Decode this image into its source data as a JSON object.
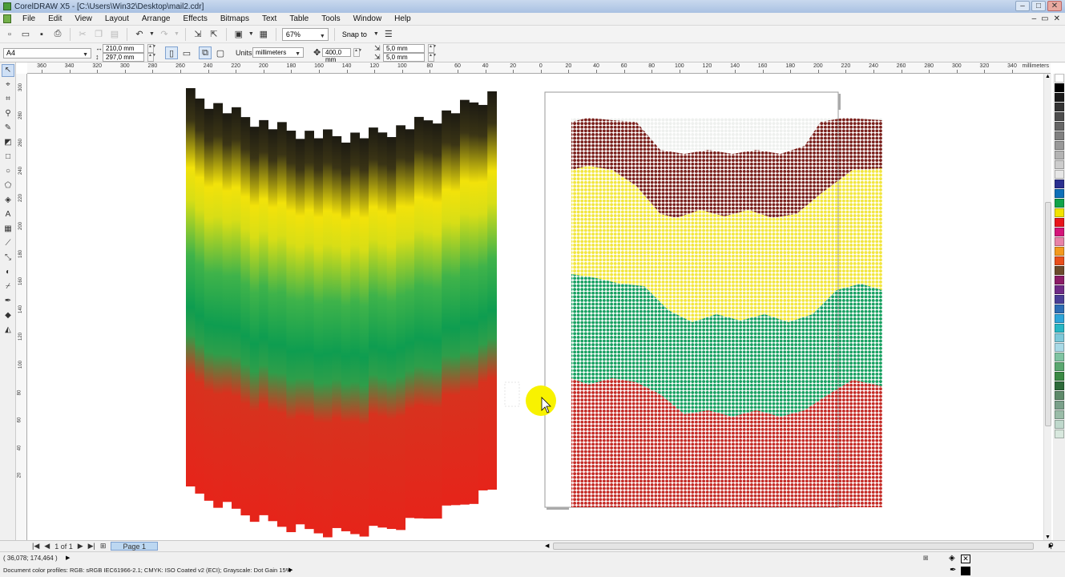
{
  "window": {
    "title": "CorelDRAW X5 - [C:\\Users\\Win32\\Desktop\\mail2.cdr]",
    "controls": [
      "–",
      "□",
      "✕"
    ]
  },
  "menu": {
    "items": [
      "File",
      "Edit",
      "View",
      "Layout",
      "Arrange",
      "Effects",
      "Bitmaps",
      "Text",
      "Table",
      "Tools",
      "Window",
      "Help"
    ],
    "mdi_controls": [
      "–",
      "▭",
      "✕"
    ]
  },
  "standard_toolbar": {
    "zoom_level": "67%",
    "snap_to_label": "Snap to"
  },
  "property_bar": {
    "paper_type": "A4",
    "page_width": "210,0 mm",
    "page_height": "297,0 mm",
    "units_label": "Units:",
    "units_value": "millimeters",
    "nudge_distance": "400,0 mm",
    "duplicate_x": "5,0 mm",
    "duplicate_y": "5,0 mm"
  },
  "rulers": {
    "unit_label": "millimeters",
    "vertical_unit_label": "millimeters",
    "h_ticks": [
      "360",
      "340",
      "320",
      "300",
      "280",
      "260",
      "240",
      "220",
      "200",
      "180",
      "160",
      "140",
      "120",
      "100",
      "80",
      "60",
      "40",
      "20",
      "0",
      "20",
      "40",
      "60",
      "80",
      "100",
      "120",
      "140",
      "160",
      "180",
      "200",
      "220",
      "240",
      "260",
      "280",
      "300",
      "320",
      "340"
    ],
    "v_ticks": [
      "300",
      "280",
      "260",
      "240",
      "220",
      "200",
      "180",
      "160",
      "140",
      "120",
      "100",
      "80",
      "60",
      "40",
      "20"
    ]
  },
  "page_navigator": {
    "page_count": "1 of 1",
    "page_tab": "Page 1"
  },
  "status": {
    "cursor_position": "( 36,078; 174,464 )",
    "color_profiles": "Document color profiles: RGB: sRGB IEC61966-2.1; CMYK: ISO Coated v2 (ECI); Grayscale: Dot Gain 15%"
  },
  "palette_colors": [
    "#ffffff",
    "#000000",
    "#1a1a1a",
    "#333333",
    "#4d4d4d",
    "#666666",
    "#808080",
    "#999999",
    "#b3b3b3",
    "#cccccc",
    "#e6e6e6",
    "#2b2f8f",
    "#0d6fb8",
    "#10a34a",
    "#f2e300",
    "#e8151b",
    "#d4147a",
    "#e883a8",
    "#f39a1e",
    "#e94e1b",
    "#6b4a2b",
    "#8c1b67",
    "#6f2a86",
    "#4a3e96",
    "#2c6db4",
    "#2da5d9",
    "#27b6c4",
    "#7cc8d9",
    "#a8d9e6",
    "#7fc4a2",
    "#5aa870",
    "#3a8a44",
    "#2d6a3a",
    "#5e8a6a",
    "#7aa08a",
    "#9abca8",
    "#bfd8cc",
    "#d8e8de"
  ]
}
